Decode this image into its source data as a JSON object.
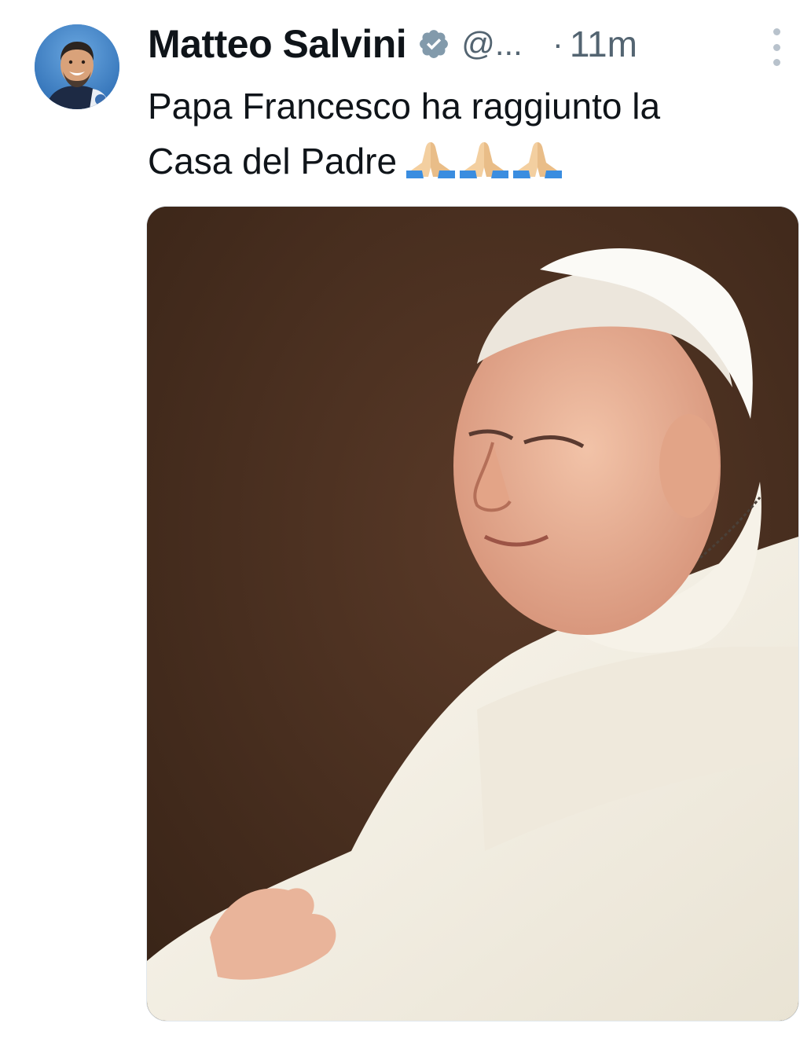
{
  "tweet": {
    "author_name": "Matteo Salvini",
    "verified_badge": "verified-badge-icon",
    "handle": "@...",
    "separator": "·",
    "timestamp": "11m",
    "text_line_1": "Papa Francesco ha raggiunto la",
    "text_line_2": "Casa del Padre",
    "emoji": [
      "folded-hands-emoji",
      "folded-hands-emoji",
      "folded-hands-emoji"
    ],
    "media": {
      "kind": "photo",
      "icon": "photo-image"
    }
  },
  "colors": {
    "primary_text": "#0f1419",
    "secondary_text": "#536471",
    "badge": "#829aab",
    "photo_background": "#452c1f",
    "avatar_background": "#3f7fc6"
  }
}
